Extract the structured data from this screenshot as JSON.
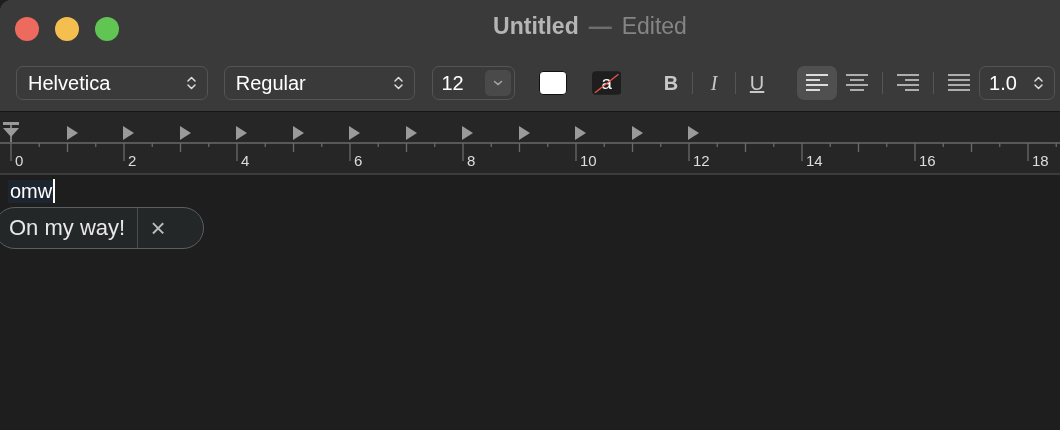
{
  "window": {
    "title": "Untitled",
    "separator": "—",
    "status": "Edited"
  },
  "toolbar": {
    "font_family": "Helvetica",
    "font_style": "Regular",
    "font_size": "12",
    "highlight_glyph": "a",
    "styles": [
      {
        "kind": "bold",
        "label": "B"
      },
      {
        "kind": "italic",
        "label": "I"
      },
      {
        "kind": "underline",
        "label": "U"
      }
    ],
    "alignment": [
      {
        "kind": "left",
        "selected": true
      },
      {
        "kind": "center",
        "selected": false
      },
      {
        "kind": "right",
        "selected": false
      },
      {
        "kind": "justify",
        "selected": false
      }
    ],
    "line_spacing": "1.0"
  },
  "ruler": {
    "labels": [
      "0",
      "2",
      "4",
      "6",
      "8",
      "10",
      "12",
      "14",
      "16",
      "18"
    ]
  },
  "document": {
    "text": "omw",
    "suggestion": "On my way!",
    "dismiss": "×"
  }
}
